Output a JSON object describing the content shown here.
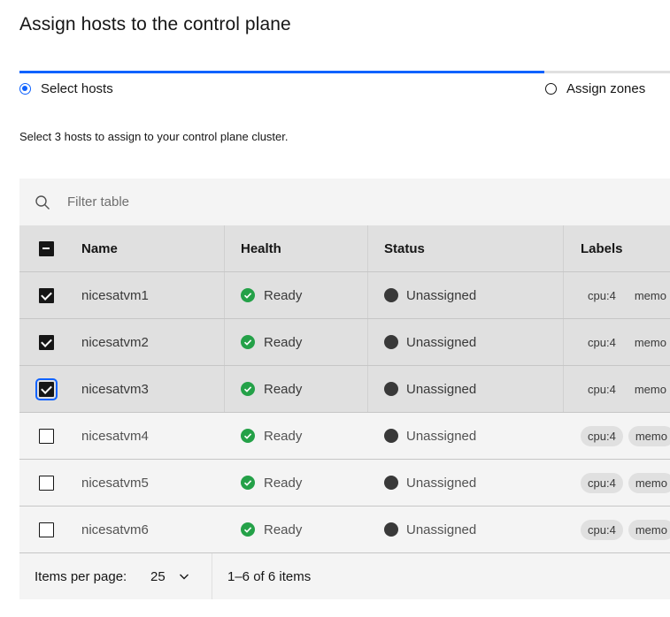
{
  "page": {
    "title": "Assign hosts to the control plane",
    "description": "Select 3 hosts to assign to your control plane cluster."
  },
  "progress": {
    "steps": [
      {
        "label": "Select hosts",
        "state": "current"
      },
      {
        "label": "Assign zones",
        "state": "incomplete"
      }
    ],
    "accent": "#0f62fe"
  },
  "table": {
    "filter_placeholder": "Filter table",
    "headers": {
      "name": "Name",
      "health": "Health",
      "status": "Status",
      "labels": "Labels"
    },
    "rows": [
      {
        "name": "nicesatvm1",
        "health": "Ready",
        "status": "Unassigned",
        "label1": "cpu:4",
        "label2": "memo",
        "selected": true
      },
      {
        "name": "nicesatvm2",
        "health": "Ready",
        "status": "Unassigned",
        "label1": "cpu:4",
        "label2": "memo",
        "selected": true
      },
      {
        "name": "nicesatvm3",
        "health": "Ready",
        "status": "Unassigned",
        "label1": "cpu:4",
        "label2": "memo",
        "selected": true
      },
      {
        "name": "nicesatvm4",
        "health": "Ready",
        "status": "Unassigned",
        "label1": "cpu:4",
        "label2": "memo",
        "selected": false
      },
      {
        "name": "nicesatvm5",
        "health": "Ready",
        "status": "Unassigned",
        "label1": "cpu:4",
        "label2": "memo",
        "selected": false
      },
      {
        "name": "nicesatvm6",
        "health": "Ready",
        "status": "Unassigned",
        "label1": "cpu:4",
        "label2": "memo",
        "selected": false
      }
    ],
    "health_color": "#24a148",
    "status_color": "#393939"
  },
  "pagination": {
    "items_per_page_label": "Items per page:",
    "items_per_page_value": "25",
    "range_text": "1–6 of 6 items"
  }
}
